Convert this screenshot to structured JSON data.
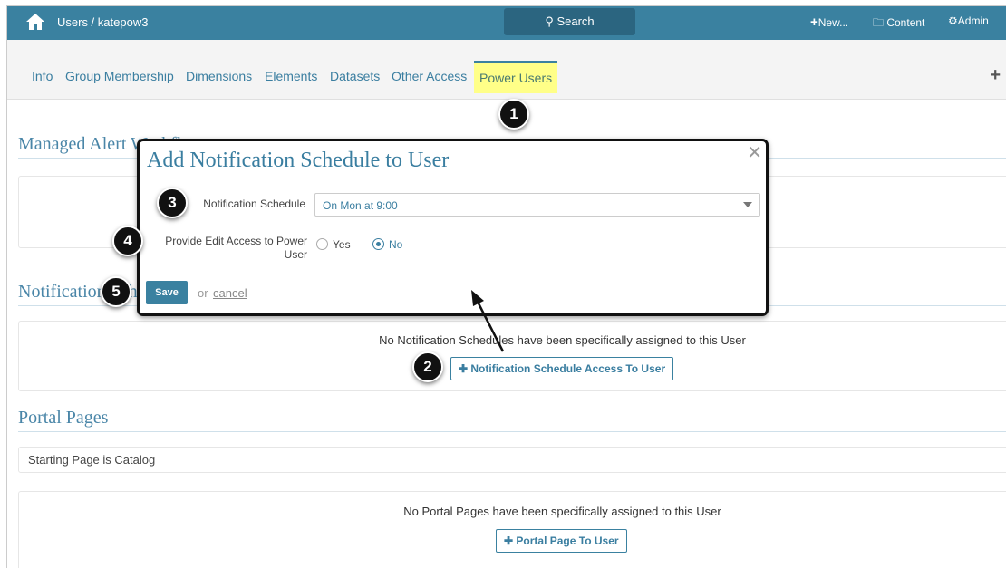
{
  "topbar": {
    "breadcrumb": "Users / katepow3",
    "search_label": "Search",
    "new_label": "New...",
    "content_label": "Content",
    "admin_label": "Admin"
  },
  "tabs": [
    {
      "label": "Info"
    },
    {
      "label": "Group Membership"
    },
    {
      "label": "Dimensions"
    },
    {
      "label": "Elements"
    },
    {
      "label": "Datasets"
    },
    {
      "label": "Other Access"
    },
    {
      "label": "Power Users",
      "active": true
    }
  ],
  "sections": {
    "managed_alert": "Managed Alert Workflows",
    "notification": "Notification Schedules",
    "notification_empty": "No Notification Schedules have been specifically assigned to this User",
    "notification_button": "Notification Schedule Access To User",
    "portal": "Portal Pages",
    "starting_page": "Starting Page is Catalog",
    "portal_empty": "No Portal Pages have been specifically assigned to this User",
    "portal_button": "Portal Page To User"
  },
  "modal": {
    "title": "Add Notification Schedule to User",
    "schedule_label": "Notification Schedule",
    "schedule_value": "On Mon at 9:00",
    "edit_label": "Provide Edit Access to Power User",
    "yes": "Yes",
    "no": "No",
    "selected": "No",
    "save": "Save",
    "or": "or",
    "cancel": "cancel"
  },
  "badges": [
    "1",
    "2",
    "3",
    "4",
    "5"
  ]
}
